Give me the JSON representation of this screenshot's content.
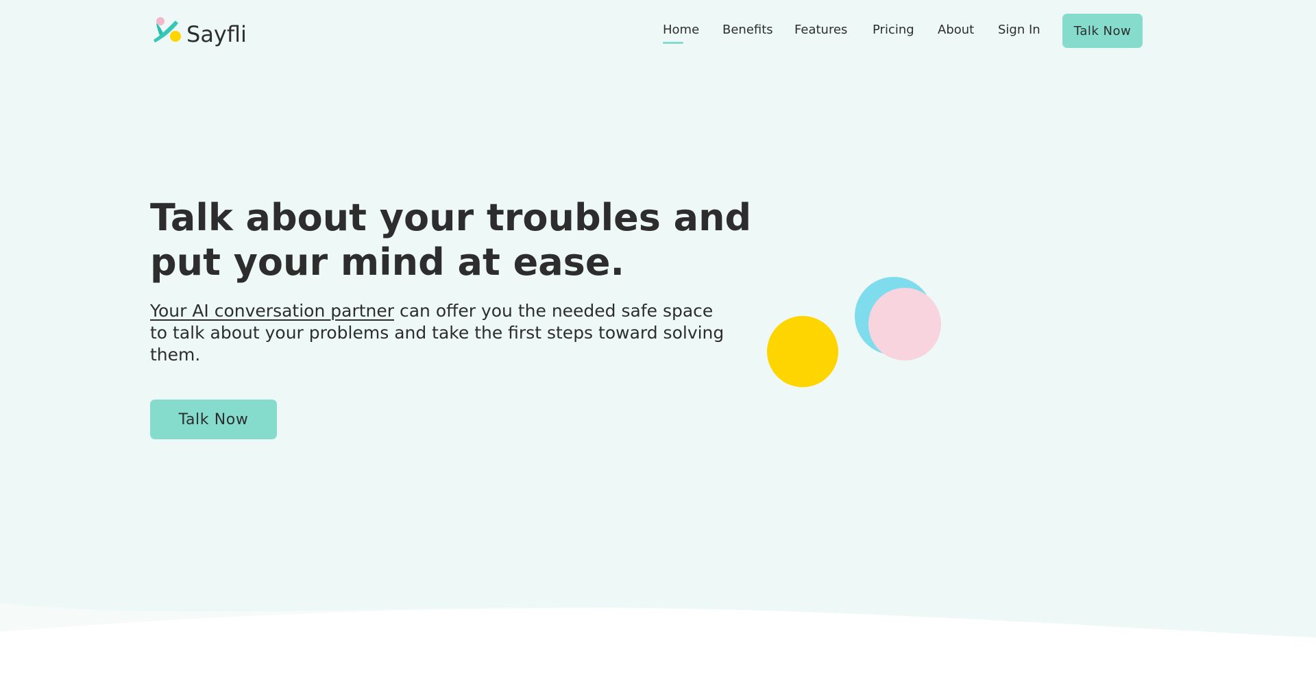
{
  "brand": {
    "name": "Sayfli",
    "colors": {
      "teal": "#86dccc",
      "teal_dark": "#2bbfae",
      "yellow": "#ffd500",
      "blue": "#7fdcec",
      "pink": "#f8d4df",
      "background": "#eef8f7",
      "text": "#2d2d2d"
    }
  },
  "nav": {
    "items": [
      {
        "label": "Home",
        "active": true
      },
      {
        "label": "Benefits",
        "active": false
      },
      {
        "label": "Features",
        "active": false
      },
      {
        "label": "Pricing",
        "active": false
      },
      {
        "label": "About",
        "active": false
      },
      {
        "label": "Sign In",
        "active": false
      }
    ],
    "cta_label": "Talk Now"
  },
  "hero": {
    "title_line1": "Talk about your troubles and",
    "title_line2": "put your mind at ease.",
    "subtitle_link": "Your AI conversation partner",
    "subtitle_rest": " can offer you the needed safe space to talk about your problems and take the first steps toward solving them.",
    "cta_label": "Talk Now"
  },
  "icons": {
    "logo": "sayfli-logo-mark",
    "decoration": "floating-circles"
  }
}
